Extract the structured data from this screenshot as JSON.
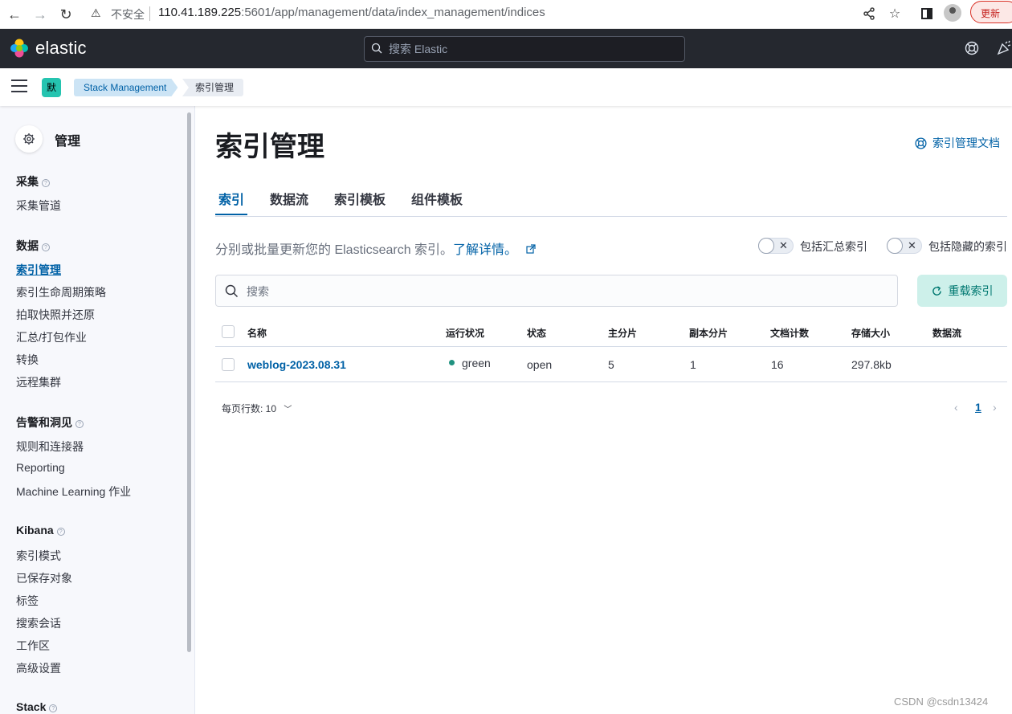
{
  "browser": {
    "insecure_label": "不安全",
    "url_host": "110.41.189.225",
    "url_rest": ":5601/app/management/data/index_management/indices",
    "update_label": "更新"
  },
  "header": {
    "logo_text": "elastic",
    "search_placeholder": "搜索 Elastic"
  },
  "breadcrumb": {
    "space_initial": "默",
    "items": [
      "Stack Management",
      "索引管理"
    ]
  },
  "sidebar": {
    "title": "管理",
    "groups": [
      {
        "label": "采集",
        "items": [
          "采集管道"
        ]
      },
      {
        "label": "数据",
        "items": [
          "索引管理",
          "索引生命周期策略",
          "拍取快照并还原",
          "汇总/打包作业",
          "转换",
          "远程集群"
        ]
      },
      {
        "label": "告警和洞见",
        "items": [
          "规则和连接器",
          "Reporting",
          "Machine Learning 作业"
        ]
      },
      {
        "label": "Kibana",
        "items": [
          "索引模式",
          "已保存对象",
          "标签",
          "搜索会话",
          "工作区",
          "高级设置"
        ]
      },
      {
        "label": "Stack",
        "items": []
      }
    ]
  },
  "main": {
    "title": "索引管理",
    "doc_link": "索引管理文档",
    "tabs": [
      "索引",
      "数据流",
      "索引模板",
      "组件模板"
    ],
    "description": "分别或批量更新您的 Elasticsearch 索引。",
    "learn_more": "了解详情。",
    "toggle_rollup": "包括汇总索引",
    "toggle_hidden": "包括隐藏的索引",
    "search_placeholder": "搜索",
    "reload_label": "重载索引",
    "columns": [
      "名称",
      "运行状况",
      "状态",
      "主分片",
      "副本分片",
      "文档计数",
      "存储大小",
      "数据流"
    ],
    "rows": [
      {
        "name": "weblog-2023.08.31",
        "health": "green",
        "status": "open",
        "primaries": "5",
        "replicas": "1",
        "docs": "16",
        "size": "297.8kb",
        "data_stream": ""
      }
    ],
    "rows_per_page": "每页行数: 10",
    "current_page": "1"
  },
  "watermark": "CSDN @csdn13424",
  "colors": {
    "accent": "#0061a6",
    "header_bg": "#25282f",
    "health_green": "#209280",
    "reload_bg": "#cdf0ea"
  }
}
